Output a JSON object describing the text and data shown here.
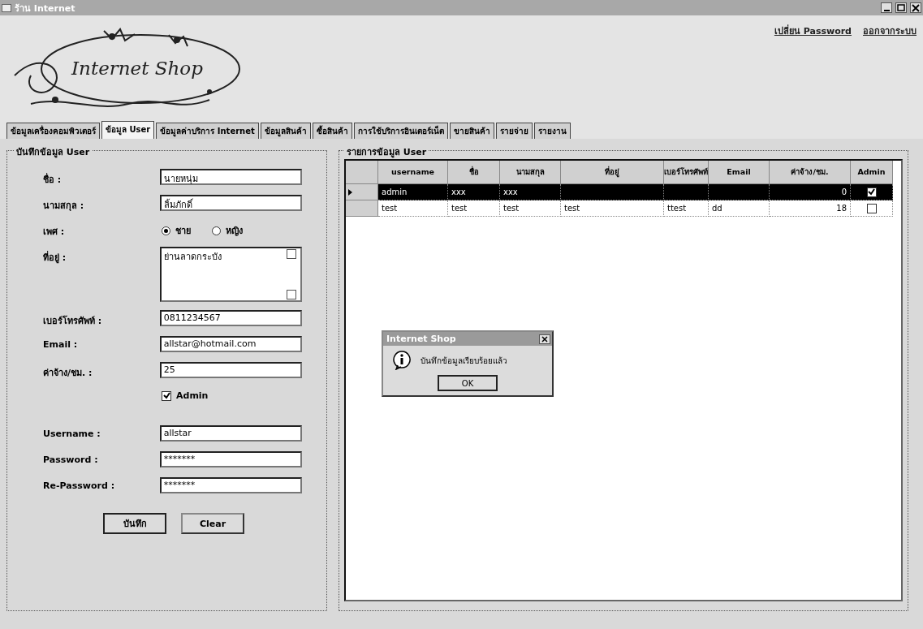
{
  "window": {
    "title": "ร้าน Internet"
  },
  "header": {
    "logo": "Internet Shop",
    "links": [
      "เปลี่ยน Password",
      "ออกจากระบบ"
    ]
  },
  "tabs": [
    {
      "label": "ข้อมูลเครื่องคอมพิวเตอร์",
      "selected": false
    },
    {
      "label": "ข้อมูล User",
      "selected": true
    },
    {
      "label": "ข้อมูลค่าบริการ Internet",
      "selected": false
    },
    {
      "label": "ข้อมูลสินค้า",
      "selected": false
    },
    {
      "label": "ซื้อสินค้า",
      "selected": false
    },
    {
      "label": "การใช้บริการอินเตอร์เน็ต",
      "selected": false
    },
    {
      "label": "ขายสินค้า",
      "selected": false
    },
    {
      "label": "รายจ่าย",
      "selected": false
    },
    {
      "label": "รายงาน",
      "selected": false
    }
  ],
  "form": {
    "title": "บันทึกข้อมูล User",
    "fields": [
      {
        "kind": "text",
        "label": "ชื่อ :",
        "value": "นายหนุ่ม"
      },
      {
        "kind": "text",
        "label": "นามสกุล :",
        "value": "ลิ้มภักดิ์"
      },
      {
        "kind": "radio",
        "label": "เพศ :",
        "options": [
          {
            "label": "ชาย",
            "selected": true
          },
          {
            "label": "หญิง",
            "selected": false
          }
        ]
      },
      {
        "kind": "textarea",
        "label": "ที่อยู่ :",
        "value": "ย่านลาดกระบัง"
      },
      {
        "kind": "text",
        "label": "เบอร์โทรศัพท์ :",
        "value": "0811234567"
      },
      {
        "kind": "text",
        "label": "Email :",
        "value": "allstar@hotmail.com"
      },
      {
        "kind": "text",
        "label": "ค่าจ้าง/ชม. :",
        "value": "25"
      },
      {
        "kind": "checkbox",
        "label": "Admin",
        "checked": true
      },
      {
        "kind": "text",
        "label": "Username :",
        "value": "allstar"
      },
      {
        "kind": "password",
        "label": "Password :",
        "value": "*******"
      },
      {
        "kind": "password",
        "label": "Re-Password :",
        "value": "*******"
      }
    ],
    "buttons": [
      "บันทึก",
      "Clear"
    ]
  },
  "grid": {
    "title": "รายการข้อมูล User",
    "columns": [
      "username",
      "ชื่อ",
      "นามสกุล",
      "ที่อยู่",
      "เบอร์โทรศัพท์",
      "Email",
      "ค่าจ้าง/ชม.",
      "Admin"
    ],
    "rows": [
      {
        "selected": true,
        "cells": [
          "admin",
          "xxx",
          "xxx",
          "",
          "",
          "",
          "0"
        ],
        "admin": true
      },
      {
        "selected": false,
        "cells": [
          "test",
          "test",
          "test",
          "test",
          "ttest",
          "dd",
          "18"
        ],
        "admin": false
      }
    ]
  },
  "dialog": {
    "title": "Internet Shop",
    "message": "บันทึกข้อมูลเรียบร้อยแล้ว",
    "button": "OK"
  }
}
